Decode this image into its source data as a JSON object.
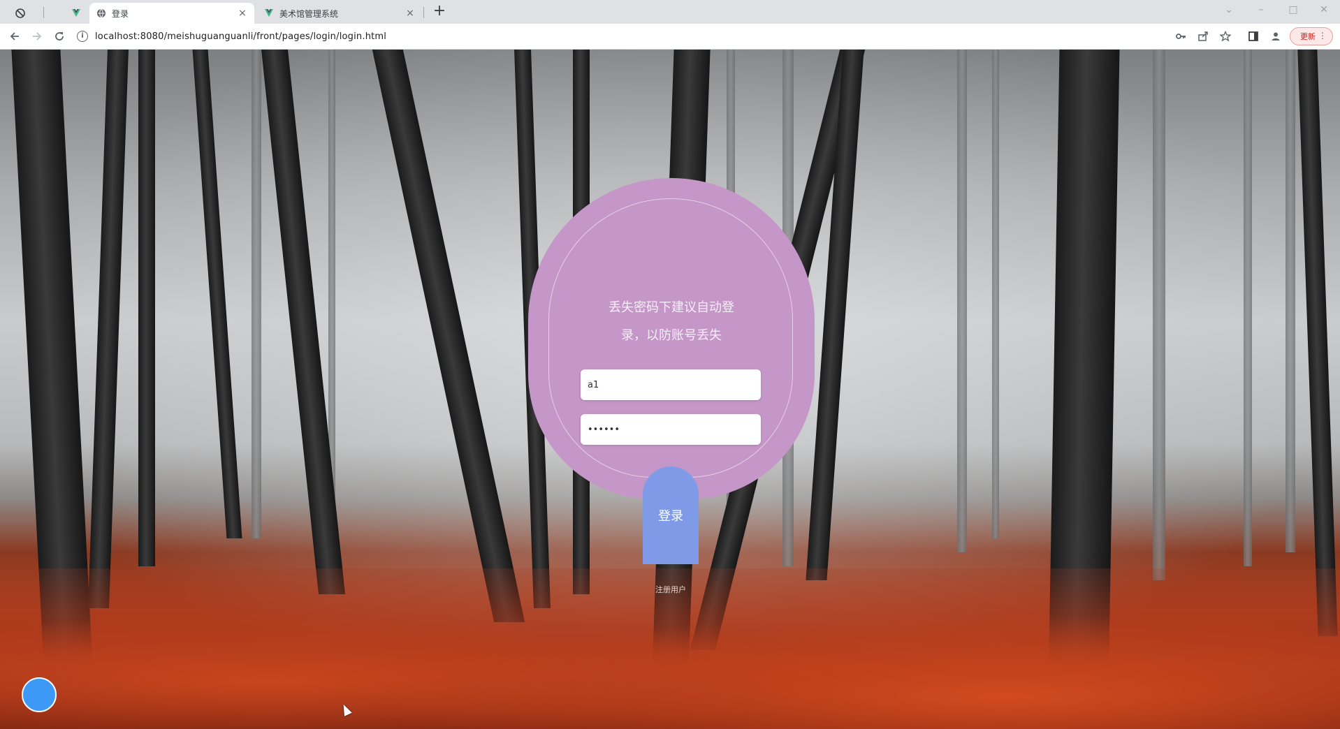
{
  "browser": {
    "tabs": [
      {
        "label": "",
        "icon": "pinned-tab-icon",
        "active": false
      },
      {
        "label": "",
        "icon": "vue-favicon",
        "active": false
      },
      {
        "label": "登录",
        "icon": "globe-favicon",
        "active": true
      },
      {
        "label": "美术馆管理系统",
        "icon": "vue-favicon",
        "active": false
      }
    ],
    "close_glyph": "×",
    "new_tab_glyph": "+",
    "address": "localhost:8080/meishuguanguanli/front/pages/login/login.html",
    "update_label": "更新",
    "menu_glyph": "⋮"
  },
  "login": {
    "message": [
      "丢失密码下建议自动登",
      "录，以防账号丢失"
    ],
    "username_value": "a1",
    "password_value": "123456",
    "login_label": "登录",
    "register_label": "注册用户"
  },
  "colors": {
    "card": "#c596c8",
    "login_button": "#7f9be8",
    "float_button": "#3d99f5"
  }
}
